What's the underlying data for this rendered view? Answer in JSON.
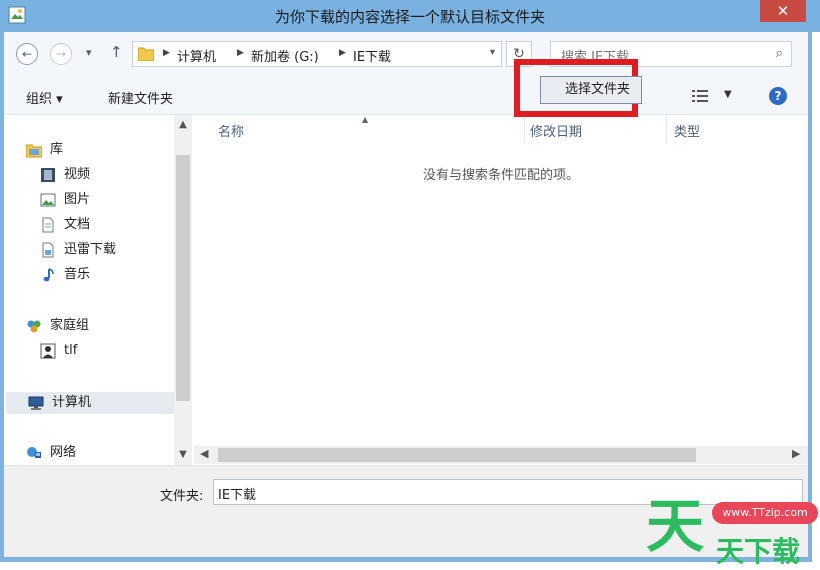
{
  "window": {
    "title": "为你下载的内容选择一个默认目标文件夹",
    "close_glyph": "✕"
  },
  "address": {
    "crumbs": [
      "计算机",
      "新加卷 (G:)",
      "IE下载"
    ],
    "search_placeholder": "搜索 IE下载"
  },
  "toolbar": {
    "organize": "组织 ▾",
    "new_folder": "新建文件夹",
    "help": "?"
  },
  "nav": {
    "items": [
      {
        "label": "库",
        "icon": "library-icon"
      },
      {
        "label": "视频",
        "icon": "video-icon"
      },
      {
        "label": "图片",
        "icon": "picture-icon"
      },
      {
        "label": "文档",
        "icon": "document-icon"
      },
      {
        "label": "迅雷下载",
        "icon": "download-library-icon"
      },
      {
        "label": "音乐",
        "icon": "music-icon"
      },
      {
        "label": "家庭组",
        "icon": "homegroup-icon"
      },
      {
        "label": "tlf",
        "icon": "user-icon"
      },
      {
        "label": "计算机",
        "icon": "computer-icon"
      },
      {
        "label": "网络",
        "icon": "network-icon"
      }
    ]
  },
  "filelist": {
    "columns": [
      "名称",
      "修改日期",
      "类型"
    ],
    "empty_message": "没有与搜索条件匹配的项。"
  },
  "footer": {
    "folder_label": "文件夹:",
    "folder_value": "IE下载",
    "select_button": "选择文件夹"
  },
  "watermark": {
    "url": "www.TTzip.com",
    "big_char": "天",
    "text": "天下载"
  },
  "colors": {
    "titlebar": "#79b2e0",
    "close": "#c74b42",
    "highlight_box": "#e01c23",
    "watermark_green": "#2dbb60",
    "watermark_pink": "#e9465a"
  }
}
